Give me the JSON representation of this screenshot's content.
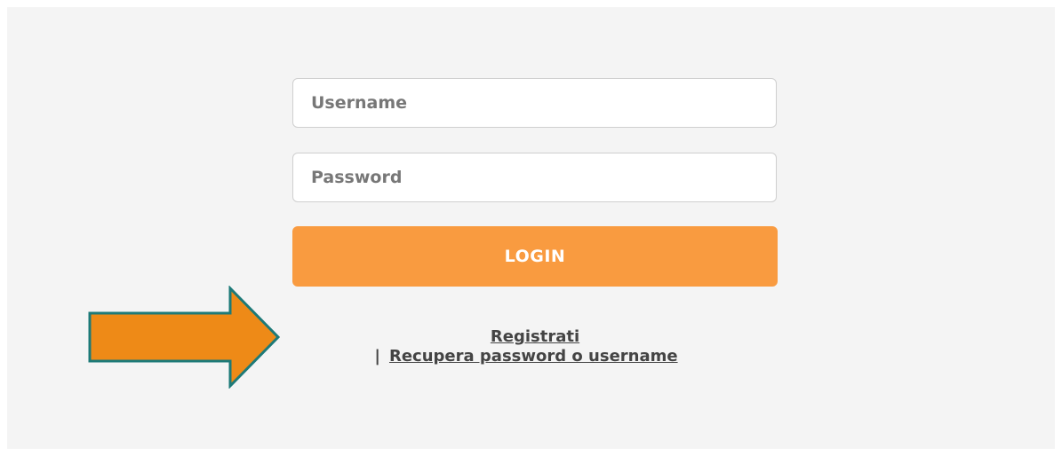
{
  "form": {
    "username_placeholder": "Username",
    "password_placeholder": "Password",
    "login_label": "LOGIN"
  },
  "links": {
    "register_label": "Registrati",
    "separator": "|",
    "recover_label": "Recupera password o username"
  },
  "annotation": {
    "arrow_icon": "arrow-right-icon"
  },
  "colors": {
    "background": "#f4f4f4",
    "login_button": "#f99b40",
    "arrow_fill": "#ee8a17",
    "arrow_stroke": "#1d7a78",
    "link_text": "#444444"
  }
}
